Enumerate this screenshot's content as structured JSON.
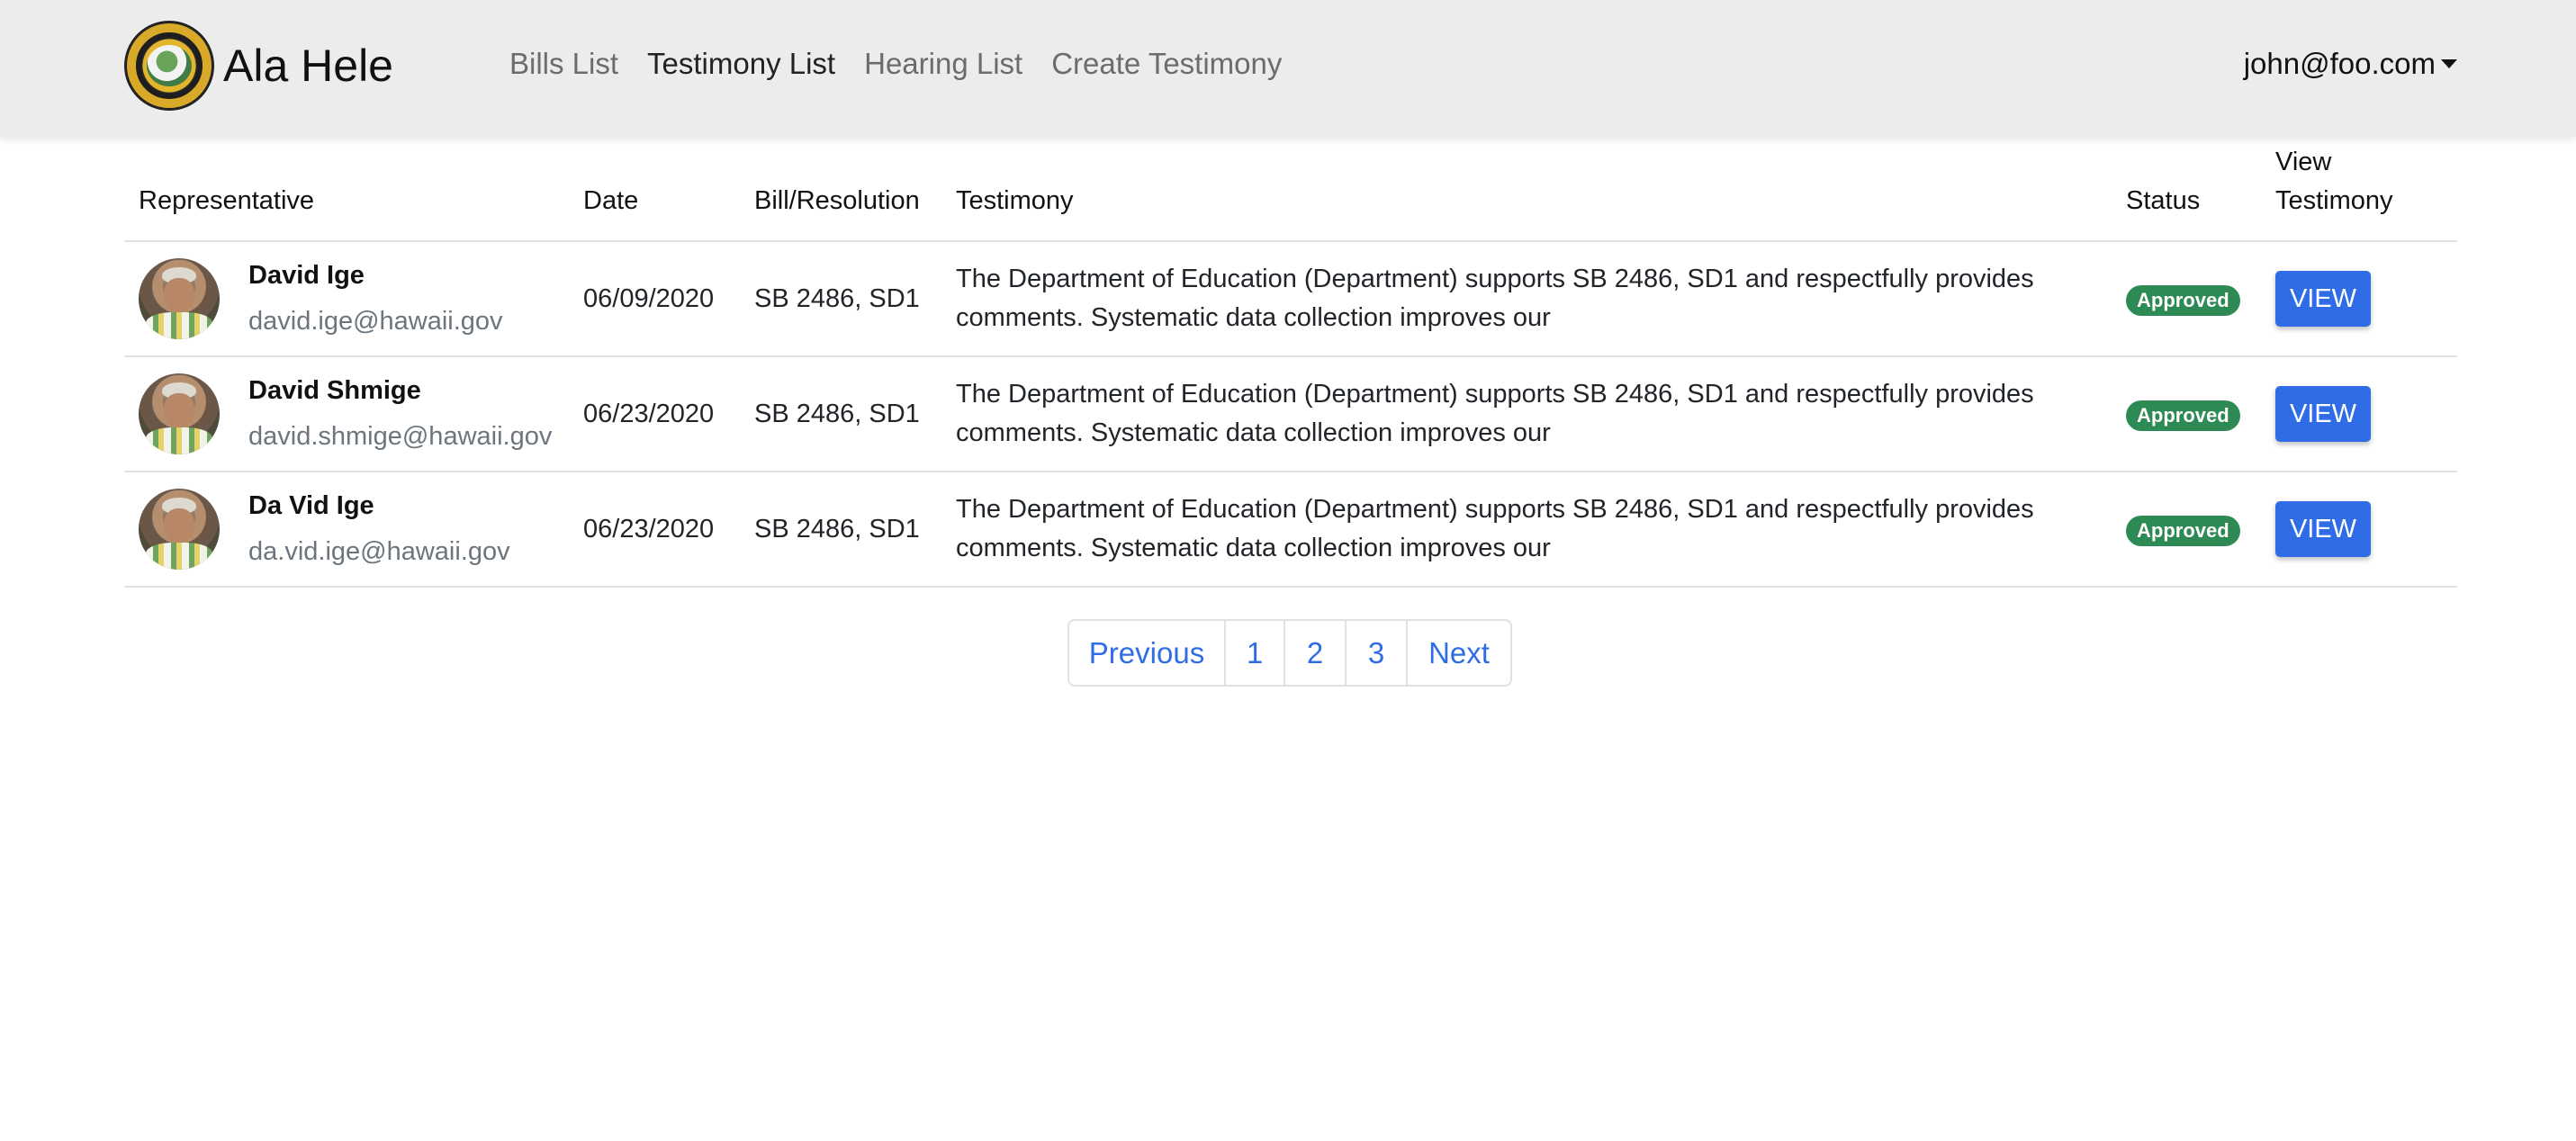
{
  "navbar": {
    "brand_title": "Ala Hele",
    "links": [
      "Bills List",
      "Testimony List",
      "Hearing List",
      "Create Testimony"
    ],
    "active_link": "Testimony List",
    "user": "john@foo.com"
  },
  "table": {
    "headers": {
      "representative": "Representative",
      "date": "Date",
      "bill": "Bill/Resolution",
      "testimony": "Testimony",
      "status": "Status",
      "view": "View Testimony"
    },
    "rows": [
      {
        "name": "David Ige",
        "email": "david.ige@hawaii.gov",
        "date": "06/09/2020",
        "bill": "SB 2486, SD1",
        "testimony": "The Department of Education (Department) supports SB 2486, SD1 and respectfully provides comments. Systematic data collection improves our",
        "status": "Approved",
        "action": "VIEW"
      },
      {
        "name": "David Shmige",
        "email": "david.shmige@hawaii.gov",
        "date": "06/23/2020",
        "bill": "SB 2486, SD1",
        "testimony": "The Department of Education (Department) supports SB 2486, SD1 and respectfully provides comments. Systematic data collection improves our",
        "status": "Approved",
        "action": "VIEW"
      },
      {
        "name": "Da Vid Ige",
        "email": "da.vid.ige@hawaii.gov",
        "date": "06/23/2020",
        "bill": "SB 2486, SD1",
        "testimony": "The Department of Education (Department) supports SB 2486, SD1 and respectfully provides comments. Systematic data collection improves our",
        "status": "Approved",
        "action": "VIEW"
      }
    ]
  },
  "pagination": {
    "previous": "Previous",
    "pages": [
      "1",
      "2",
      "3"
    ],
    "next": "Next"
  },
  "colors": {
    "navbar_bg": "#ececec",
    "primary": "#2f6ce6",
    "success": "#2e8a55"
  }
}
